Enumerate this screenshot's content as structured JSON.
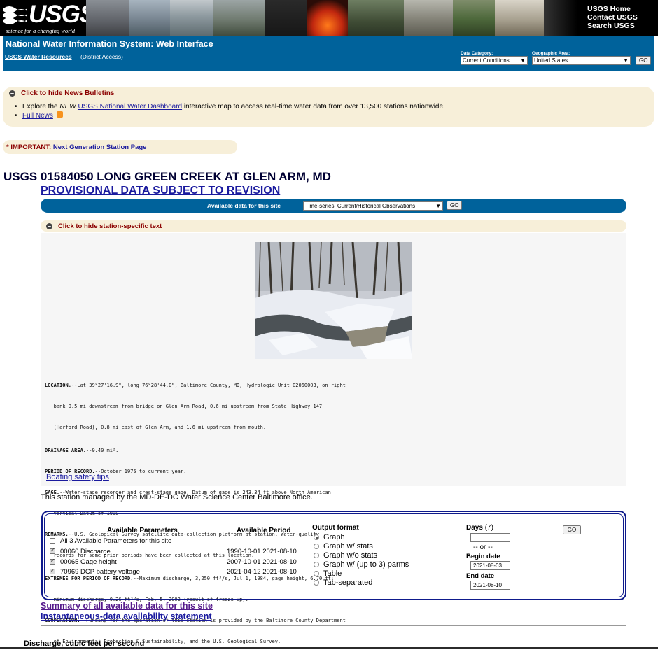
{
  "banner": {
    "logo_text": "USGS",
    "logo_tagline": "science for a changing world",
    "top_links": [
      "USGS Home",
      "Contact USGS",
      "Search USGS"
    ]
  },
  "header": {
    "title": "National Water Information System: Web Interface",
    "water_resources_link": "USGS Water Resources",
    "district_access": "(District Access)",
    "data_category_label": "Data Category:",
    "data_category_value": "Current Conditions",
    "geographic_area_label": "Geographic Area:",
    "geographic_area_value": "United States",
    "go_label": "GO"
  },
  "news": {
    "toggle_label": "Click to hide News Bulletins",
    "item1_prefix": "Explore the ",
    "item1_new": "NEW",
    "item1_link": "USGS National Water Dashboard",
    "item1_suffix": " interactive map to access real-time water data from over 13,500 stations nationwide.",
    "item2_link": "Full News"
  },
  "important": {
    "prefix": "* IMPORTANT: ",
    "link": "Next Generation Station Page"
  },
  "station": {
    "title": "USGS 01584050 LONG GREEN CREEK AT GLEN ARM, MD",
    "provisional": "PROVISIONAL DATA SUBJECT TO REVISION",
    "available_label": "Available data for this site",
    "timeseries_value": "Time-series:   Current/Historical Observations",
    "go_label": "GO",
    "toggle_label": "Click to hide station-specific text",
    "boating_link": "Boating safety tips",
    "managed_text": "This station managed by the MD-DE-DC Water Science Center Baltimore office."
  },
  "description": {
    "location_label": "LOCATION.",
    "location_l1": "--Lat 39°27'16.9\", long 76°28'44.0\", Baltimore County, MD, Hydrologic Unit 02060003, on right",
    "location_l2": "   bank 0.5 mi downstream from bridge on Glen Arm Road, 0.6 mi upstream from State Highway 147",
    "location_l3": "   (Harford Road), 0.8 mi east of Glen Arm, and 1.6 mi upstream from mouth.",
    "drainage_label": "DRAINAGE AREA.",
    "drainage": "--9.40 mi².",
    "period_label": "PERIOD OF RECORD.",
    "period": "--October 1975 to current year.",
    "gage_label": "GAGE.",
    "gage_l1": "--Water-stage recorder and crest-stage gage. Datum of gage is 243.34 ft above North American",
    "gage_l2": "   Vertical Datum of 1988.",
    "remarks_label": "REMARKS.",
    "remarks_l1": "--U.S. Geological Survey satellite data-collection platform at station. Water-quality",
    "remarks_l2": "   records for some prior periods have been collected at this location.",
    "extremes_label": "EXTREMES FOR PERIOD OF RECORD.",
    "extremes_l1": "--Maximum discharge, 3,250 ft³/s, Jul 1, 1984, gage height, 6.70 ft;",
    "extremes_l2": "   minimum discharge, 0.26 ft³/s, Feb. 5, 2002 (result of freeze up).",
    "coop_label": "COOPERATION.",
    "coop_l1": "--Funding for the operation of this station is provided by the Baltimore County Department",
    "coop_l2": "   of Environmental Protection & Sustainability, and the U.S. Geological Survey."
  },
  "params": {
    "header_params": "Available Parameters",
    "header_period": "Available Period",
    "all_label": "All 3 Available Parameters for this site",
    "rows": [
      {
        "label": "00060 Discharge",
        "period": "1990-10-01 2021-08-10",
        "checked": true
      },
      {
        "label": "00065 Gage height",
        "period": "2007-10-01 2021-08-10",
        "checked": true
      },
      {
        "label": "70969 DCP battery voltage",
        "period": "2021-04-12 2021-08-10",
        "checked": true
      }
    ],
    "output_header": "Output format",
    "formats": [
      "Graph",
      "Graph w/ stats",
      "Graph w/o stats",
      "Graph w/ (up to 3) parms",
      "Table",
      "Tab-separated"
    ],
    "days_label": "Days",
    "days_hint": "(7)",
    "or_text": "-- or --",
    "begin_label": "Begin date",
    "begin_value": "2021-08-03",
    "end_label": "End date",
    "end_value": "2021-08-10",
    "go_label": "GO"
  },
  "links": {
    "summary": "Summary of all available data for this site",
    "instantaneous": "Instantaneous-data availability statement"
  },
  "graph_heading": "Discharge, cubic feet per second",
  "colors": {
    "header_blue": "#00629b",
    "bulletin_bg": "#f7efd9",
    "form_border": "#0e1a8c"
  }
}
